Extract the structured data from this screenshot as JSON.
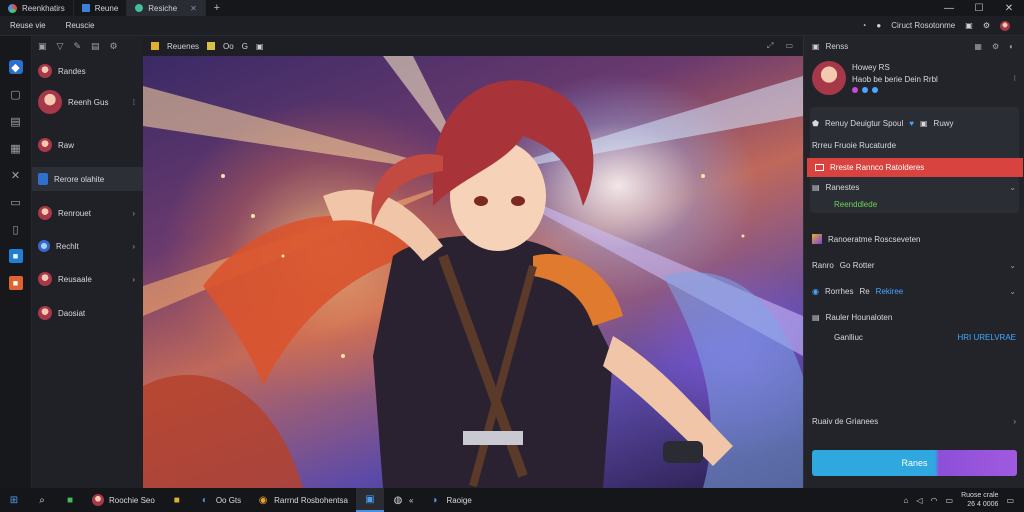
{
  "tabs": [
    {
      "label": "Reenkhatirs",
      "icon": "app-logo-icon"
    },
    {
      "label": "Reune",
      "icon": "window-icon"
    },
    {
      "label": "Resiche",
      "icon": "game-icon"
    }
  ],
  "topline": {
    "left": [
      "Reuse vie",
      "Reuscie"
    ],
    "right_text": "Ciruct Rosotonme"
  },
  "chanlist": {
    "items": [
      {
        "label": "Randes"
      },
      {
        "label": "Reenh Gus"
      },
      {
        "label": "Raw"
      },
      {
        "label": "Rerore olahite"
      },
      {
        "label": "Renrouet"
      },
      {
        "label": "Rechlt"
      },
      {
        "label": "Reusaale"
      },
      {
        "label": "Daosiat"
      }
    ]
  },
  "main_toolbar": {
    "items": [
      "Reuenes",
      "Oo",
      "G"
    ]
  },
  "rpanel": {
    "title": "Renss",
    "profile_name": "Howey RS",
    "profile_sub": "Haob be berie Dein Rrbl",
    "row1": "Renuy Deuigtur Spoul",
    "row1_tag": "Ruwy",
    "row2": "Rrreu Fruoie Rucaturde",
    "alert": "Rreste Rannco Ratolderes",
    "row3": "Ranestes",
    "row3_sub": "Reenddlede",
    "row4": "Ranoeratme Roscseveten",
    "row5_a": "Ranro",
    "row5_b": "Go Rotter",
    "row6_a": "Rorrhes",
    "row6_b": "Re",
    "row6_c": "Rekiree",
    "row7": "Rauler Hounaloten",
    "row8_a": "Ganlliuc",
    "row8_b": "HRI URELVRAE",
    "bottom_row": "Ruaiv de Grianees",
    "button": "Ranes",
    "colors": {
      "accent_blue": "#2fa8e0",
      "accent_purple": "#a05ae0",
      "alert_red": "#d9433f",
      "green": "#6fd15a"
    }
  },
  "taskbar": {
    "items": [
      {
        "label": "Roochie Seo",
        "icon": "browser-icon"
      },
      {
        "label": "Oo Gts",
        "icon": "edge-icon"
      },
      {
        "label": "Rarrnd Rosbohentsa",
        "icon": "chrome-icon"
      },
      {
        "label": "Raoige",
        "icon": "chat-icon"
      }
    ],
    "clock_time": "Ruose crale",
    "clock_date": "26 4 0006"
  }
}
